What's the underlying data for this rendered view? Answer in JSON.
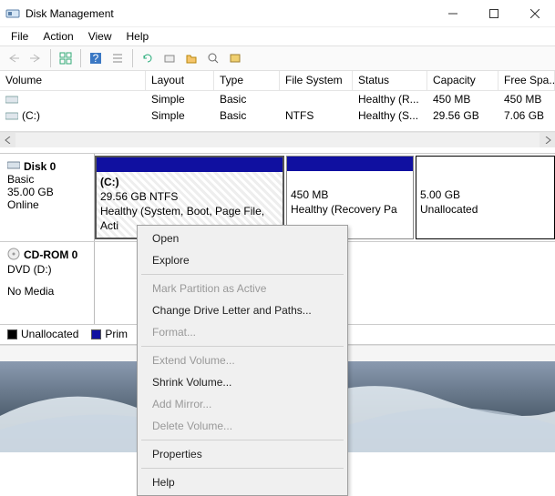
{
  "window": {
    "title": "Disk Management"
  },
  "menu": {
    "file": "File",
    "action": "Action",
    "view": "View",
    "help": "Help"
  },
  "list": {
    "headers": {
      "volume": "Volume",
      "layout": "Layout",
      "type": "Type",
      "fs": "File System",
      "status": "Status",
      "capacity": "Capacity",
      "free": "Free Spa..."
    },
    "rows": [
      {
        "volume": "",
        "layout": "Simple",
        "type": "Basic",
        "fs": "",
        "status": "Healthy (R...",
        "capacity": "450 MB",
        "free": "450 MB"
      },
      {
        "volume": "(C:)",
        "layout": "Simple",
        "type": "Basic",
        "fs": "NTFS",
        "status": "Healthy (S...",
        "capacity": "29.56 GB",
        "free": "7.06 GB"
      }
    ]
  },
  "disk0": {
    "title": "Disk 0",
    "kind": "Basic",
    "size": "35.00 GB",
    "state": "Online",
    "parts": [
      {
        "label": "(C:)",
        "line2": "29.56 GB NTFS",
        "line3": "Healthy (System, Boot, Page File, Acti"
      },
      {
        "label": "",
        "line2": "450 MB",
        "line3": "Healthy (Recovery Pa"
      },
      {
        "label": "",
        "line2": "5.00 GB",
        "line3": "Unallocated"
      }
    ]
  },
  "cdrom": {
    "title": "CD-ROM 0",
    "kind": "DVD (D:)",
    "state": "No Media"
  },
  "legend": {
    "unallocated": "Unallocated",
    "primary": "Prim"
  },
  "context": {
    "open": "Open",
    "explore": "Explore",
    "mark": "Mark Partition as Active",
    "change": "Change Drive Letter and Paths...",
    "format": "Format...",
    "extend": "Extend Volume...",
    "shrink": "Shrink Volume...",
    "mirror": "Add Mirror...",
    "delete": "Delete Volume...",
    "props": "Properties",
    "help": "Help"
  }
}
